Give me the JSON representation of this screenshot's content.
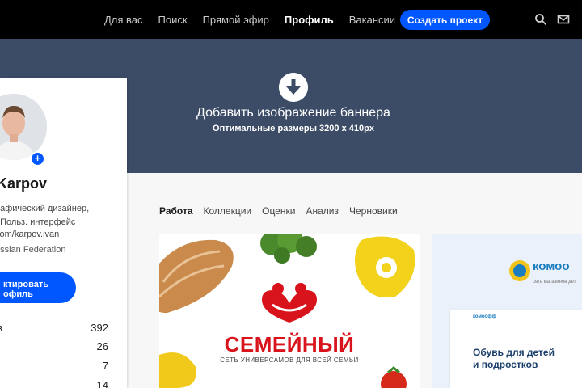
{
  "nav": {
    "items": [
      {
        "label": "Для вас",
        "active": false
      },
      {
        "label": "Поиск",
        "active": false
      },
      {
        "label": "Прямой эфир",
        "active": false
      },
      {
        "label": "Профиль",
        "active": true
      },
      {
        "label": "Вакансии",
        "active": false
      }
    ],
    "create_label": "Создать проект",
    "icons": [
      "search-icon",
      "mail-icon"
    ]
  },
  "banner": {
    "title": "Добавить изображение баннера",
    "subtitle": "Оптимальные размеры 3200 x 410px",
    "icon": "download-arrow-icon"
  },
  "profile": {
    "name": "Karpov",
    "occupation_line1": "рафический дизайнер,",
    "occupation_line2": ", Польз. интерфейс",
    "link": "com/karpov.ivan",
    "location": "ussian Federation",
    "edit_label_line1": "ктировать",
    "edit_label_line2": "офиль",
    "stats": [
      {
        "label": "з",
        "value": "392"
      },
      {
        "label": "",
        "value": "26"
      },
      {
        "label": "",
        "value": "7"
      },
      {
        "label": "",
        "value": "14"
      }
    ]
  },
  "tabs": [
    {
      "label": "Работа",
      "active": true
    },
    {
      "label": "Коллекции",
      "active": false
    },
    {
      "label": "Оценки",
      "active": false
    },
    {
      "label": "Анализ",
      "active": false
    },
    {
      "label": "Черновики",
      "active": false
    }
  ],
  "projects": [
    {
      "logo": "СЕМЕЙНЫЙ",
      "tagline": "СЕТЬ УНИВЕРСАМОВ ДЛЯ ВСЕЙ СЕМЬИ"
    },
    {
      "logo": "комоо",
      "tagline": "сеть магазинов дет",
      "inner_logo": "комоофф",
      "headline_line1": "Обувь для детей",
      "headline_line2": "и подростков"
    }
  ],
  "colors": {
    "accent": "#0057ff",
    "topbar": "#000000",
    "banner": "#3c4c67",
    "brand_red": "#d8131b",
    "brand_blue": "#1a7dc0"
  }
}
